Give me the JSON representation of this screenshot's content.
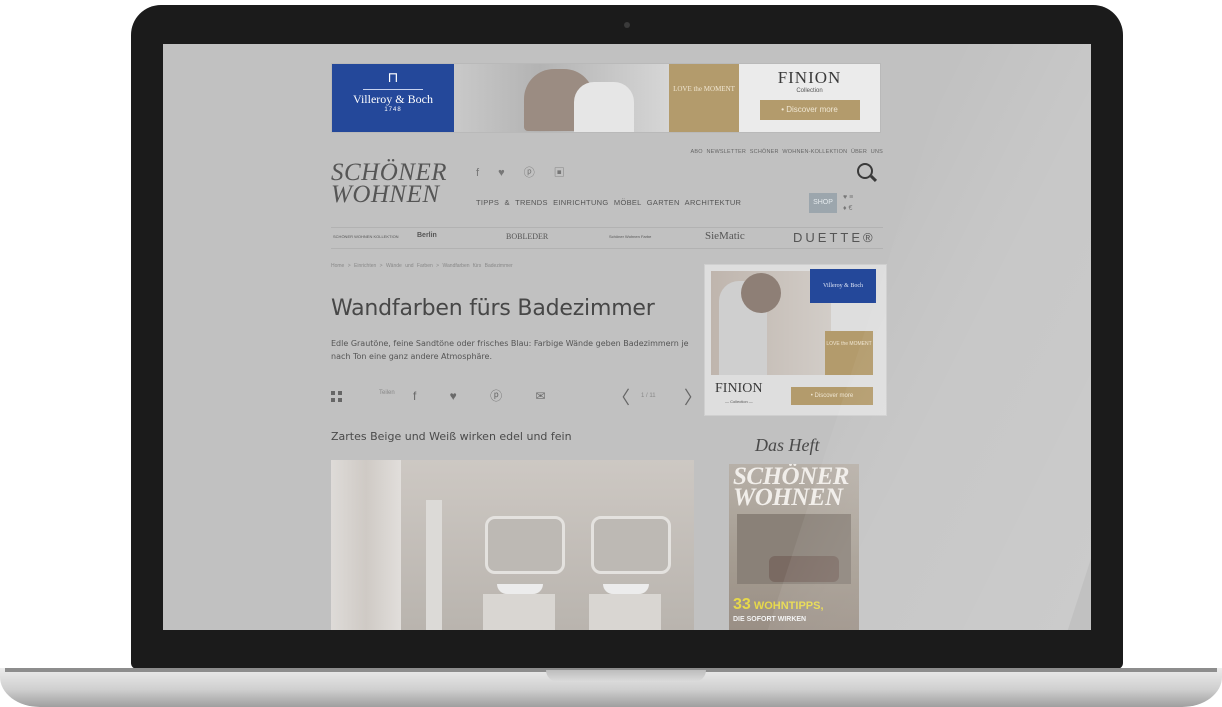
{
  "banner": {
    "brand_emblem": "⊓",
    "brand_name": "Villeroy & Boch",
    "brand_year": "1748",
    "tagline": "LOVE the MOMENT",
    "collection_title": "FINION",
    "collection_sub": "Collection",
    "cta": "• Discover more"
  },
  "header": {
    "toplinks": "ABO   NEWSLETTER   SCHÖNER WOHNEN-KOLLEKTION   ÜBER UNS",
    "logo_line1": "SCHÖNER",
    "logo_line2": "WOHNEN",
    "social_icons": "f ♥ ⓟ ▣",
    "nav": "TIPPS & TRENDS   EINRICHTUNG   MÖBEL   GARTEN   ARCHITEKTUR",
    "shop_label": "SHOP",
    "mini_icons": "♥  ≡\n♦  €"
  },
  "brands": [
    "SCHÖNER WOHNEN KOLLEKTION",
    "Berlin",
    "BOBLEDER",
    "Schöner Wohnen Farbe",
    "SieMatic",
    "DUETTE®"
  ],
  "breadcrumb": "Home  >  Einrichten  >  Wände und Farben  >  Wandfarben fürs Badezimmer",
  "article": {
    "headline": "Wandfarben fürs Badezimmer",
    "lead": "Edle Grautöne, feine Sandtöne oder frisches Blau: Farbige Wände geben Badezimmern je nach Ton eine ganz andere Atmosphäre.",
    "share_label": "Teilen",
    "share_icons": "f ♥ ⓟ ✉",
    "page_indicator": "1 / 11",
    "prev": "〈",
    "next": "〉",
    "slide_caption": "Zartes Beige und Weiß wirken edel und fein"
  },
  "side_ad": {
    "brand": "Villeroy & Boch",
    "tagline": "LOVE the MOMENT",
    "collection_title": "FINION",
    "collection_sub": "— Collection —",
    "cta": "• Discover more"
  },
  "magazine": {
    "section_title": "Das Heft",
    "cover_title_1": "SCHÖNER",
    "cover_title_2": "WOHNEN",
    "cover_number": "33",
    "cover_headline_1": "WOHNTIPPS,",
    "cover_headline_2": "DIE SOFORT WIRKEN"
  }
}
